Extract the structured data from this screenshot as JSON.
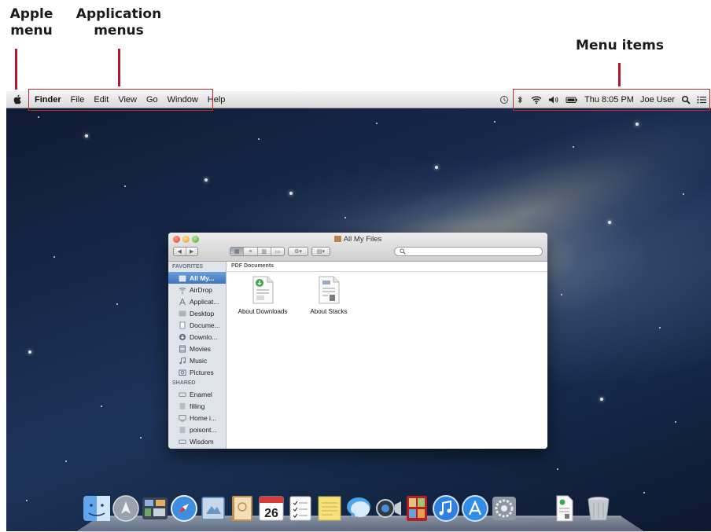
{
  "callouts": {
    "apple_menu": "Apple menu",
    "application_menus": "Application menus",
    "menu_items": "Menu items"
  },
  "menubar": {
    "app_name": "Finder",
    "menus": [
      "File",
      "Edit",
      "View",
      "Go",
      "Window",
      "Help"
    ],
    "clock": "Thu 8:05 PM",
    "user": "Joe User",
    "status_icons": [
      "time-machine-icon",
      "bluetooth-icon",
      "wifi-icon",
      "volume-icon",
      "battery-icon"
    ]
  },
  "finder": {
    "title": "All My Files",
    "section_header": "PDF Documents",
    "sidebar": {
      "favorites_header": "FAVORITES",
      "favorites": [
        {
          "label": "All My...",
          "icon": "all-my-files-icon",
          "selected": true
        },
        {
          "label": "AirDrop",
          "icon": "airdrop-icon"
        },
        {
          "label": "Applicat...",
          "icon": "applications-icon"
        },
        {
          "label": "Desktop",
          "icon": "desktop-icon"
        },
        {
          "label": "Docume...",
          "icon": "documents-icon"
        },
        {
          "label": "Downlo...",
          "icon": "downloads-icon"
        },
        {
          "label": "Movies",
          "icon": "movies-icon"
        },
        {
          "label": "Music",
          "icon": "music-icon"
        },
        {
          "label": "Pictures",
          "icon": "pictures-icon"
        }
      ],
      "shared_header": "SHARED",
      "shared": [
        {
          "label": "Enamel",
          "icon": "network-computer-icon"
        },
        {
          "label": "filling",
          "icon": "network-computer-icon"
        },
        {
          "label": "Home i...",
          "icon": "network-display-icon"
        },
        {
          "label": "poisont...",
          "icon": "network-computer-icon"
        },
        {
          "label": "Wisdom",
          "icon": "network-computer-icon"
        }
      ]
    },
    "files": [
      {
        "name": "About Downloads"
      },
      {
        "name": "About Stacks"
      }
    ]
  },
  "dock": {
    "apps": [
      "finder-icon",
      "launchpad-icon",
      "mission-control-icon",
      "safari-icon",
      "mail-icon",
      "contacts-icon",
      "calendar-icon",
      "reminders-icon",
      "notes-icon",
      "messages-icon",
      "facetime-icon",
      "photo-booth-icon",
      "itunes-icon",
      "app-store-icon",
      "system-preferences-icon",
      "document-stack-icon",
      "trash-icon"
    ],
    "calendar_day": "26"
  }
}
